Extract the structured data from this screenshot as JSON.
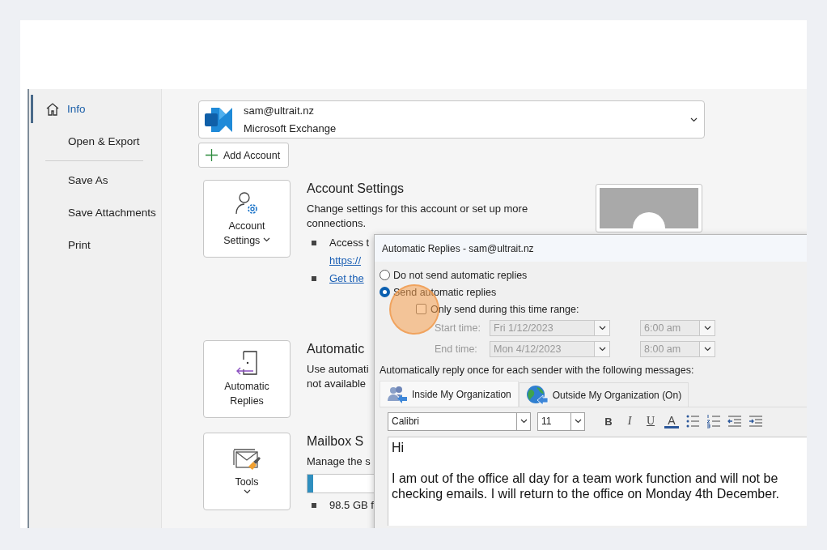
{
  "nav": {
    "groups": [
      [
        {
          "label": "Info",
          "selected": true
        },
        {
          "label": "Open & Export",
          "selected": false
        }
      ],
      [
        {
          "label": "Save As",
          "selected": false
        },
        {
          "label": "Save Attachments",
          "selected": false
        },
        {
          "label": "Print",
          "selected": false
        }
      ]
    ]
  },
  "account": {
    "email": "sam@ultrait.nz",
    "type": "Microsoft Exchange"
  },
  "add_account": "Add Account",
  "sections": [
    {
      "button": "Account",
      "button_line2": "Settings",
      "has_menu": true,
      "title": "Account Settings",
      "description": [
        "Change settings for this account or set up more",
        "connections."
      ],
      "bullets": [
        {
          "lines": [
            {
              "kind": "text",
              "text": "Access t"
            },
            {
              "kind": "link",
              "text": "https://"
            }
          ]
        },
        {
          "lines": [
            {
              "kind": "link",
              "text": "Get the"
            }
          ]
        }
      ]
    },
    {
      "button": "Automatic",
      "button_line2": "Replies",
      "has_menu": false,
      "title": "Automatic",
      "description": [
        "Use automati",
        "not available"
      ]
    },
    {
      "button": "Tools",
      "has_menu": true,
      "title": "Mailbox S",
      "description": [
        "Manage the s"
      ],
      "meter": {
        "level": 0.02
      },
      "bullets": [
        {
          "lines": [
            {
              "kind": "text",
              "text": "98.5 GB f"
            }
          ]
        }
      ]
    }
  ],
  "dialog": {
    "title": "Automatic Replies - sam@ultrait.nz",
    "options": [
      {
        "label": "Do not send automatic replies",
        "selected": false
      },
      {
        "label": "Send automatic replies",
        "selected": true
      }
    ],
    "time_range": {
      "label": "Only send during this time range:",
      "checked": false,
      "disabled": true
    },
    "times": [
      {
        "label": "Start time:",
        "date": "Fri 1/12/2023",
        "time": "6:00 am"
      },
      {
        "label": "End time:",
        "date": "Mon 4/12/2023",
        "time": "8:00 am"
      }
    ],
    "prompt": "Automatically reply once for each sender with the following messages:",
    "tabs": [
      {
        "label": "Inside My Organization",
        "selected": true
      },
      {
        "label": "Outside My Organization (On)",
        "selected": false
      }
    ],
    "font": "Calibri",
    "size": "11",
    "format_buttons": [
      {
        "kind": "bold",
        "glyph": "B"
      },
      {
        "kind": "italic",
        "glyph": "I"
      },
      {
        "kind": "underline",
        "glyph": "U"
      },
      {
        "kind": "color",
        "glyph": "A"
      }
    ],
    "list_buttons": [
      {
        "kind": "bullets"
      },
      {
        "kind": "numbering"
      },
      {
        "kind": "outdent"
      },
      {
        "kind": "indent"
      }
    ],
    "message": [
      "Hi",
      "I am out of the office all day for a team work function and will not be checking emails. I will return to the office on Monday 4th December."
    ]
  }
}
